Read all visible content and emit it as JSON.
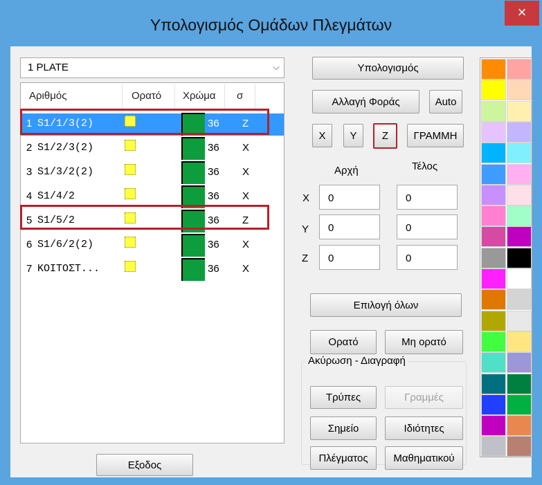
{
  "window": {
    "title": "Υπολογισμός Ομάδων Πλεγμάτων",
    "close_label": "×"
  },
  "combo": {
    "value": "1 PLATE"
  },
  "list": {
    "columns": [
      "Αριθμός",
      "Ορατό",
      "Χρώμα",
      "σ"
    ],
    "rows": [
      {
        "num": "1",
        "name": "S1/1/3(2)",
        "value": "36",
        "sigma": "Z",
        "selected": true
      },
      {
        "num": "2",
        "name": "S1/2/3(2)",
        "value": "36",
        "sigma": "X",
        "selected": false
      },
      {
        "num": "3",
        "name": "S1/3/2(2)",
        "value": "36",
        "sigma": "X",
        "selected": false
      },
      {
        "num": "4",
        "name": "S1/4/2",
        "value": "36",
        "sigma": "X",
        "selected": false
      },
      {
        "num": "5",
        "name": "S1/5/2",
        "value": "36",
        "sigma": "Z",
        "selected": false
      },
      {
        "num": "6",
        "name": "S1/6/2(2)",
        "value": "36",
        "sigma": "X",
        "selected": false
      },
      {
        "num": "7",
        "name": "ΚΟΙΤΟΣΤ...",
        "value": "36",
        "sigma": "X",
        "selected": false
      }
    ],
    "swatch_color": "#0d9d3c"
  },
  "buttons": {
    "calculate": "Υπολογισμός",
    "change_direction": "Αλλαγή Φοράς",
    "auto": "Auto",
    "axis_x": "X",
    "axis_y": "Y",
    "axis_z": "Z",
    "line": "ΓΡΑΜΜΗ",
    "select_all": "Επιλογή όλων",
    "visible": "Ορατό",
    "invisible": "Μη ορατό",
    "holes": "Τρύπες",
    "lines": "Γραμμές",
    "point": "Σημείο",
    "properties": "Ιδιότητες",
    "mesh": "Πλέγματος",
    "math": "Μαθηματικού",
    "exit": "Εξοδος"
  },
  "coords": {
    "start_label": "Αρχή",
    "end_label": "Τέλος",
    "axes": [
      "X",
      "Y",
      "Z"
    ],
    "start": [
      "0",
      "0",
      "0"
    ],
    "end": [
      "0",
      "0",
      "0"
    ]
  },
  "group_label": "Ακύρωση - Διαγραφή",
  "palette": [
    [
      "#ff8c00",
      "#ffa3a3"
    ],
    [
      "#ffff00",
      "#ffd8b8"
    ],
    [
      "#cdf59d",
      "#fff0b0"
    ],
    [
      "#e6c3ff",
      "#c4b5ff"
    ],
    [
      "#00b4ff",
      "#80f0ff"
    ],
    [
      "#3f9dff",
      "#ffb0f0"
    ],
    [
      "#c890ff",
      "#ffe0e8"
    ],
    [
      "#ff80d0",
      "#a0ffc8"
    ],
    [
      "#d54ba4",
      "#c000c0"
    ],
    [
      "#999999",
      "#000000"
    ],
    [
      "#ff20ff",
      "#ffffff"
    ],
    [
      "#e07800",
      "#d4d4d4"
    ],
    [
      "#b0a800",
      "#e8e8e8"
    ],
    [
      "#40ff40",
      "#ffe680"
    ],
    [
      "#50e0c8",
      "#9c98d8"
    ],
    [
      "#007080",
      "#008040"
    ],
    [
      "#2040ff",
      "#00b040"
    ],
    [
      "#c000c0",
      "#e88850"
    ],
    [
      "#c0c0c8",
      "#b88070"
    ]
  ]
}
